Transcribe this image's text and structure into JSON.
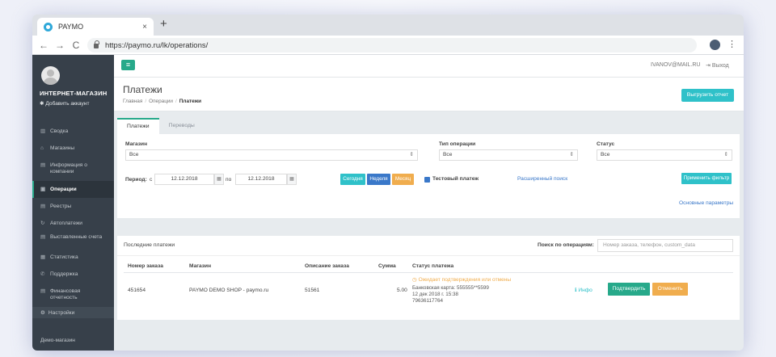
{
  "browser": {
    "tab_title": "PAYMO",
    "tab_close": "×",
    "new_tab": "+",
    "url": "https://paymo.ru/lk/operations/",
    "nav_back": "←",
    "nav_forward": "→",
    "nav_reload": "C",
    "menu": "⋮"
  },
  "sidebar": {
    "shop_name": "ИНТЕРНЕТ-МАГАЗИН",
    "add_account": "Добавить аккаунт",
    "items": [
      {
        "icon": "chart-icon",
        "glyph": "▥",
        "label": "Сводка"
      },
      {
        "icon": "bank-icon",
        "glyph": "⌂",
        "label": "Магазины"
      },
      {
        "icon": "document-icon",
        "glyph": "▤",
        "label": "Информация о компании"
      },
      {
        "icon": "operations-icon",
        "glyph": "▣",
        "label": "Операции"
      },
      {
        "icon": "registry-icon",
        "glyph": "▤",
        "label": "Реестры"
      },
      {
        "icon": "refresh-icon",
        "glyph": "↻",
        "label": "Автоплатежи"
      },
      {
        "icon": "invoice-icon",
        "glyph": "▤",
        "label": "Выставленные счета"
      },
      {
        "icon": "stats-icon",
        "glyph": "▦",
        "label": "Статистика"
      },
      {
        "icon": "phone-icon",
        "glyph": "✆",
        "label": "Поддержка"
      },
      {
        "icon": "report-icon",
        "glyph": "▤",
        "label": "Финансовая отчетность"
      }
    ],
    "active_index": 3,
    "settings": "Настройки",
    "demo": "Демо-магазин"
  },
  "topbar": {
    "menu_glyph": "≡",
    "email": "IVANOV@MAIL.RU",
    "logout": "Выход"
  },
  "page": {
    "title": "Платежи",
    "breadcrumb": [
      "Главная",
      "Операции",
      "Платежи"
    ],
    "export_button": "Выгрузить отчет"
  },
  "tabs": [
    "Платежи",
    "Переводы"
  ],
  "filter": {
    "shop_label": "Магазин",
    "shop_value": "Все",
    "optype_label": "Тип операции",
    "optype_value": "Все",
    "status_label": "Статус",
    "status_value": "Все",
    "arrow": "⇕",
    "period_label": "Период:",
    "from": "с",
    "to": "по",
    "date_from": "12.12.2018",
    "date_to": "12.12.2018",
    "today": "Сегодня",
    "week": "Неделя",
    "month": "Месяц",
    "test_payment": "Тестовый платеж",
    "advanced_search": "Расширенный поиск",
    "apply": "Применить фильтр",
    "basic_params": "Основные параметры"
  },
  "payments": {
    "title": "Последние платежи",
    "search_label": "Поиск по операциям:",
    "search_placeholder": "Номер заказа, телефон, custom_data",
    "columns": [
      "Номер заказа",
      "Магазин",
      "Описание заказа",
      "Сумма",
      "Статус платежа"
    ],
    "rows": [
      {
        "order": "451654",
        "shop": "PAYMO DEMO SHOP - paymo.ru",
        "description": "51561",
        "sum": "5.00",
        "status": "Ожидает подтверждения или отмены",
        "card": "Банковская карта: 555555**5599",
        "date": "12 дек 2018 г. 15:38",
        "phone": "79636117764",
        "info": "Инфо",
        "confirm": "Подтвердить",
        "cancel": "Отменить"
      }
    ]
  },
  "colors": {
    "sidebar": "#37404a",
    "accent_green": "#27a98a",
    "accent_teal": "#2fc1c9",
    "orange": "#f0ad4e",
    "blue": "#3a78c9"
  }
}
